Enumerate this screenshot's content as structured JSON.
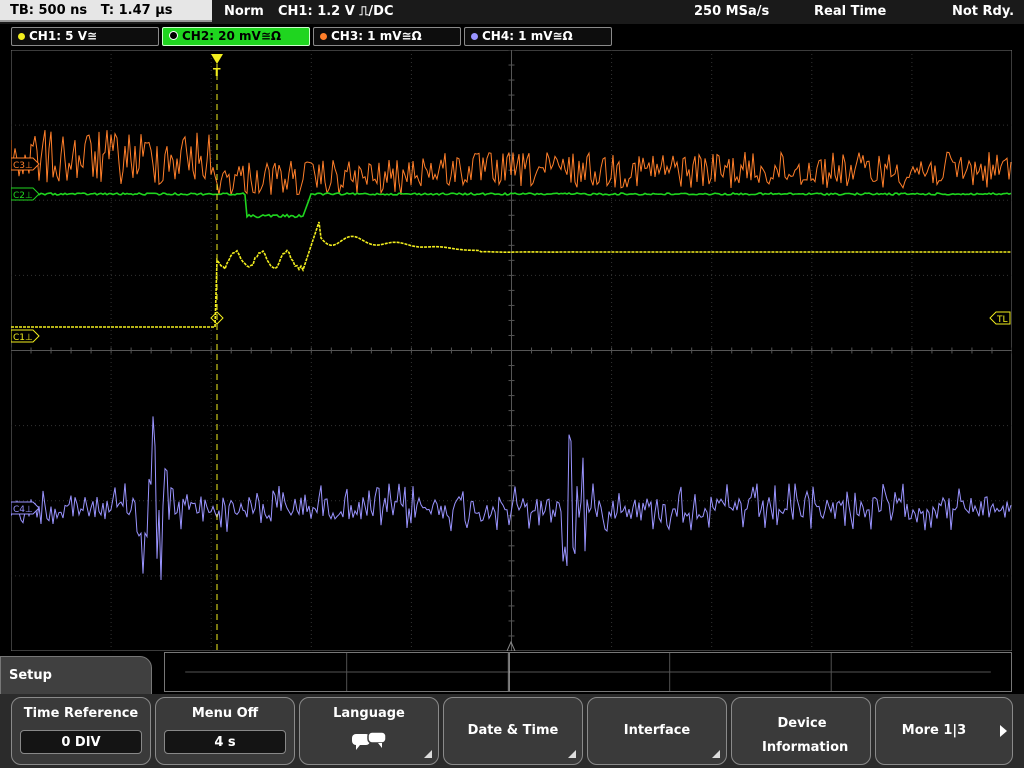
{
  "status_bar": {
    "timebase": "TB: 500 ns",
    "trigger_time": "T: 1.47 µs",
    "trigger_mode": "Norm",
    "trigger_source": "CH1: 1.2 V ⎍/DC",
    "sample_rate": "250 MSa/s",
    "acq_mode": "Real Time",
    "state": "Not Rdy."
  },
  "channels": [
    {
      "label": "CH1: 5 V≅",
      "color": "#f2ee1e"
    },
    {
      "label": "CH2: 20 mV≅Ω",
      "color": "#1fd51f"
    },
    {
      "label": "CH3: 1 mV≅Ω",
      "color": "#ff7f2a"
    },
    {
      "label": "CH4: 1 mV≅Ω",
      "color": "#9a94ff"
    }
  ],
  "markers": {
    "c3": "C3⊥",
    "c2": "C2⊥",
    "c1": "C1⊥",
    "c4": "C4⊥",
    "trigger_level": "TL",
    "trigger_pos": "T"
  },
  "menu": {
    "title": "Setup",
    "buttons": [
      {
        "label": "Time Reference",
        "value": "0 DIV"
      },
      {
        "label": "Menu Off",
        "value": "4 s"
      },
      {
        "label": "Language",
        "icon": "speech-bubble-icon"
      },
      {
        "label": "Date & Time"
      },
      {
        "label": "Interface"
      },
      {
        "label": "Device Information"
      },
      {
        "label": "More 1|3"
      }
    ]
  }
}
